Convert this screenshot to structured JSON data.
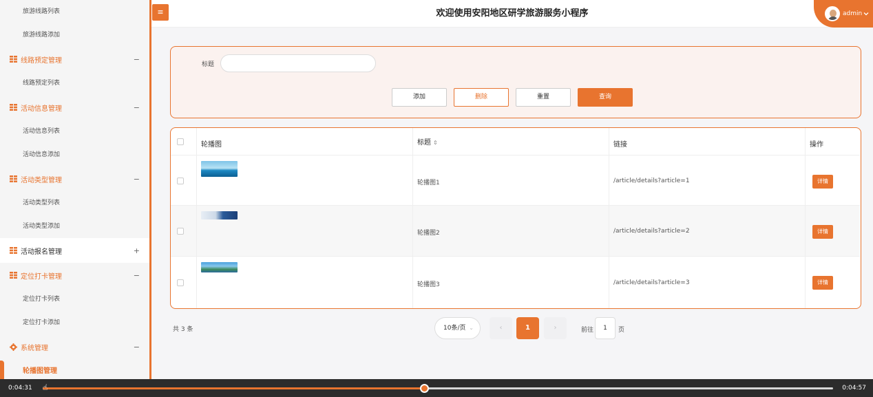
{
  "header": {
    "title": "欢迎使用安阳地区研学旅游服务小程序",
    "user": "admin",
    "menu_icon": "≡"
  },
  "sidebar": {
    "items": [
      {
        "type": "sub",
        "label": "旅游线路列表"
      },
      {
        "type": "sub",
        "label": "旅游线路添加"
      },
      {
        "type": "group",
        "label": "线路预定管理",
        "toggle": "−",
        "plain": false
      },
      {
        "type": "sub",
        "label": "线路预定列表"
      },
      {
        "type": "group",
        "label": "活动信息管理",
        "toggle": "−",
        "plain": false
      },
      {
        "type": "sub",
        "label": "活动信息列表"
      },
      {
        "type": "sub",
        "label": "活动信息添加"
      },
      {
        "type": "group",
        "label": "活动类型管理",
        "toggle": "−",
        "plain": false
      },
      {
        "type": "sub",
        "label": "活动类型列表"
      },
      {
        "type": "sub",
        "label": "活动类型添加"
      },
      {
        "type": "group",
        "label": "活动报名管理",
        "toggle": "+",
        "plain": true
      },
      {
        "type": "group",
        "label": "定位打卡管理",
        "toggle": "−",
        "plain": false
      },
      {
        "type": "sub",
        "label": "定位打卡列表"
      },
      {
        "type": "sub",
        "label": "定位打卡添加"
      },
      {
        "type": "group",
        "label": "系统管理",
        "toggle": "−",
        "plain": false,
        "icon": "gear"
      },
      {
        "type": "active",
        "label": "轮播图管理"
      }
    ]
  },
  "search": {
    "label": "标题",
    "value": "",
    "placeholder": ""
  },
  "buttons": {
    "add": "添加",
    "delete": "删除",
    "reset": "重置",
    "query": "查询"
  },
  "table": {
    "columns": [
      "轮播图",
      "标题",
      "链接",
      "操作"
    ],
    "sort_icon": "⇕",
    "rows": [
      {
        "title": "轮播图1",
        "link": "/article/details?article=1",
        "action": "详情"
      },
      {
        "title": "轮播图2",
        "link": "/article/details?article=2",
        "action": "详情"
      },
      {
        "title": "轮播图3",
        "link": "/article/details?article=3",
        "action": "详情"
      }
    ]
  },
  "pagination": {
    "total": "共 3 条",
    "page_size": "10条/页",
    "current": "1",
    "goto_label": "前往",
    "goto_value": "1",
    "goto_suffix": "页",
    "prev": "‹",
    "next": "›"
  },
  "video": {
    "current_time": "0:04:31",
    "total_time": "0:04:57",
    "progress": 0.4826
  },
  "colors": {
    "accent": "#e8742f"
  }
}
